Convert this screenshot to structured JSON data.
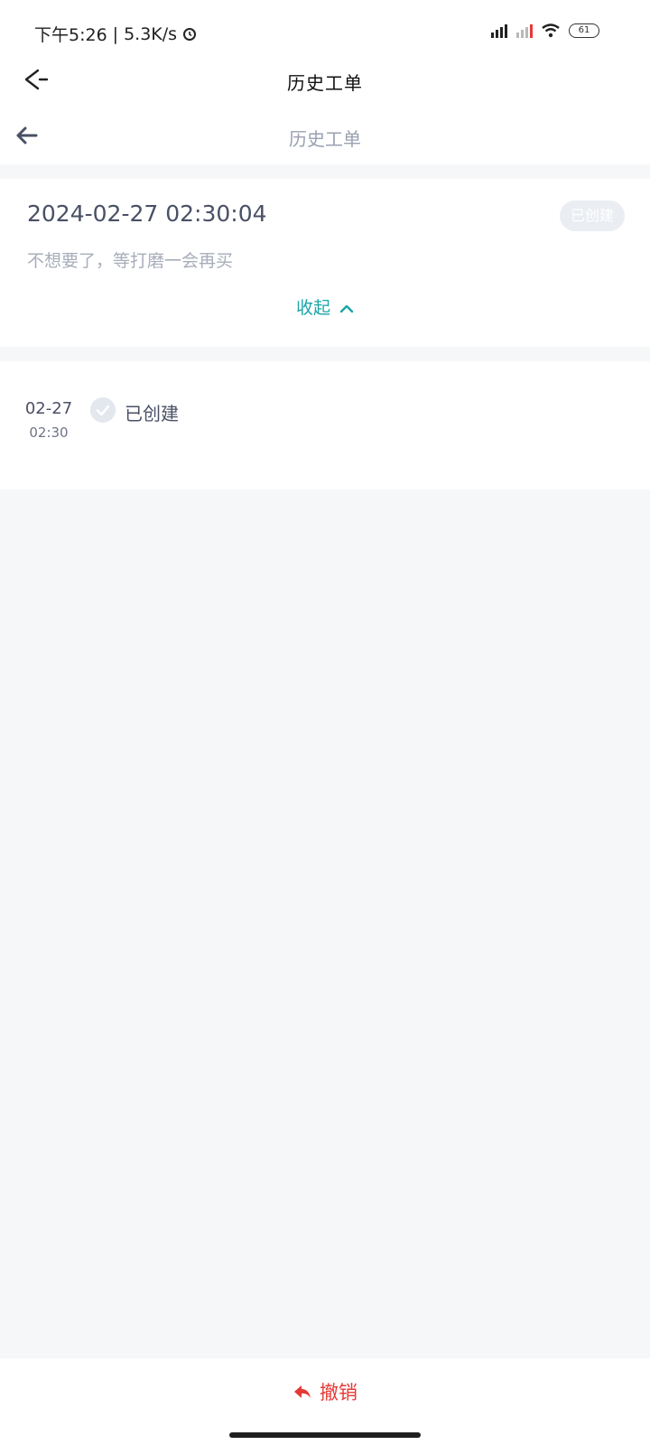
{
  "status_bar": {
    "time": "下午5:26",
    "network_speed": "5.3K/s",
    "battery": "61",
    "icons": [
      "alarm-icon",
      "signal-icon",
      "wifi-icon",
      "battery-icon"
    ]
  },
  "app_header": {
    "title": "历史工单",
    "exit_icon": "exit-icon"
  },
  "page_nav": {
    "title": "历史工单",
    "back_icon": "arrow-left-icon"
  },
  "ticket": {
    "datetime": "2024-02-27 02:30:04",
    "status_badge": "已创建",
    "description": "不想要了，等打磨一会再买",
    "collapse_label": "收起",
    "accent_color": "#1aa6a6"
  },
  "timeline": [
    {
      "date": "02-27",
      "time": "02:30",
      "status": "已创建"
    }
  ],
  "footer": {
    "revoke_label": "撤销",
    "revoke_color": "#e53935"
  }
}
